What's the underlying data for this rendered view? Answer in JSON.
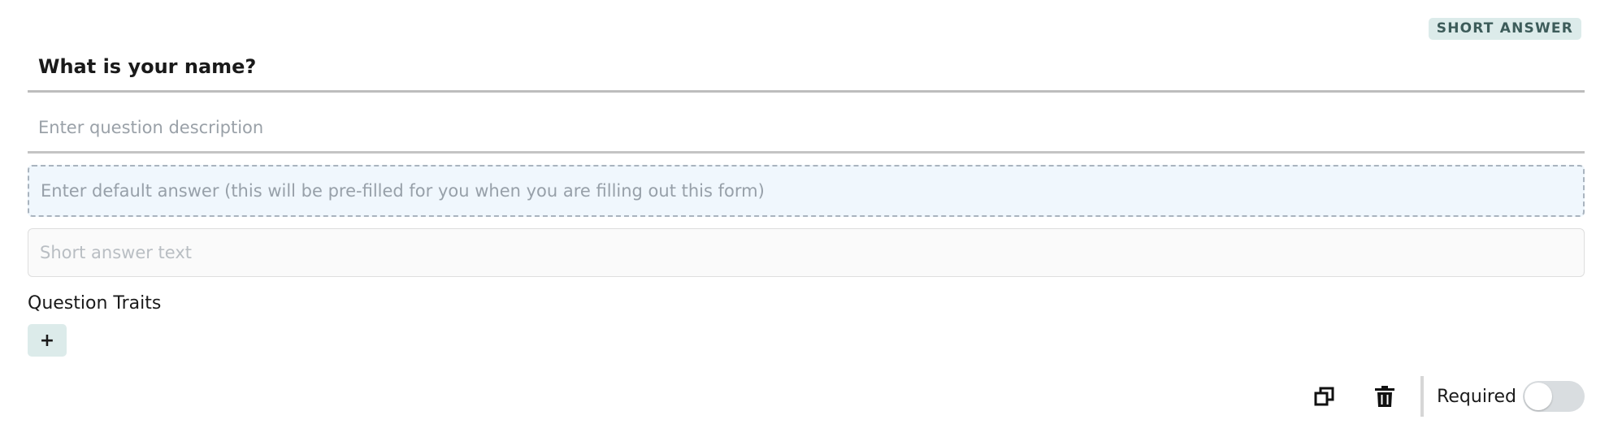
{
  "question": {
    "type_badge": "SHORT ANSWER",
    "title": "What is your name?",
    "description_placeholder": "Enter question description",
    "default_answer_placeholder": "Enter default answer (this will be pre-filled for you when you are filling out this form)",
    "short_answer_placeholder": "Short answer text"
  },
  "traits": {
    "label": "Question Traits",
    "add_label": "+"
  },
  "footer": {
    "duplicate_icon": "copy-icon",
    "delete_icon": "trash-icon",
    "required_label": "Required",
    "required_on": false
  },
  "colors": {
    "badge_bg": "#dcebea",
    "default_answer_bg": "#f0f7fd",
    "toggle_off": "#d9dde0"
  }
}
